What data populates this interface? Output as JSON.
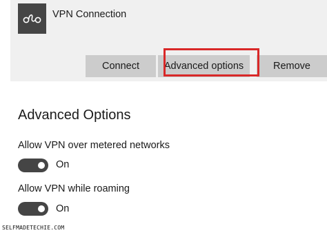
{
  "vpn_connection": {
    "name": "VPN Connection",
    "icon": "vpn-link-icon",
    "buttons": {
      "connect": "Connect",
      "advanced_options": "Advanced options",
      "remove": "Remove"
    },
    "highlighted_button": "advanced_options"
  },
  "advanced_options": {
    "title": "Advanced Options",
    "settings": [
      {
        "label": "Allow VPN over metered networks",
        "state": "On",
        "enabled": true
      },
      {
        "label": "Allow VPN while roaming",
        "state": "On",
        "enabled": true
      }
    ]
  },
  "watermark": "SELFMADETECHIE.COM",
  "colors": {
    "card_background": "#f0f0f0",
    "tile_background": "#454545",
    "button_background": "#cccccc",
    "highlight": "#d92828",
    "toggle_on": "#454545"
  }
}
